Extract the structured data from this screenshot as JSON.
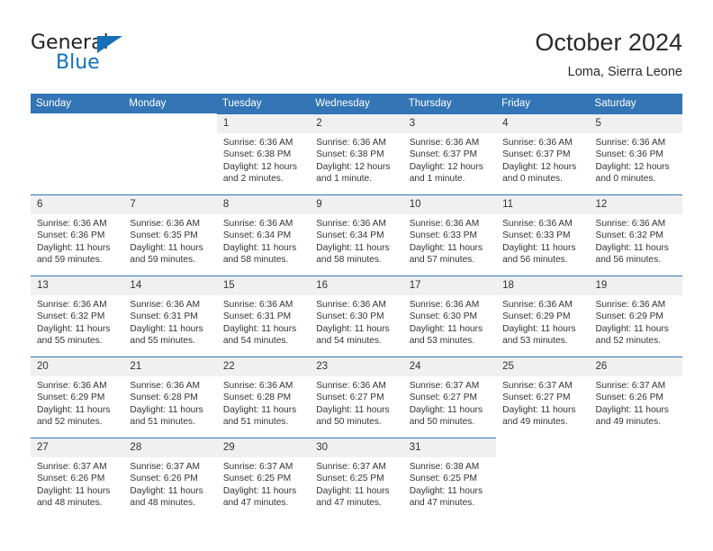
{
  "brand": {
    "name_top": "General",
    "name_bottom": "Blue",
    "accent_color": "#1570b8"
  },
  "header": {
    "title": "October 2024",
    "subtitle": "Loma, Sierra Leone",
    "header_bg_color": "#3375b5",
    "daynum_bg_color": "#f0f0f0"
  },
  "weekday_headers": [
    "Sunday",
    "Monday",
    "Tuesday",
    "Wednesday",
    "Thursday",
    "Friday",
    "Saturday"
  ],
  "labels": {
    "sunrise": "Sunrise:",
    "sunset": "Sunset:",
    "daylight": "Daylight:"
  },
  "weeks": [
    [
      {
        "day": "",
        "blank": true
      },
      {
        "day": "",
        "blank": true
      },
      {
        "day": "1",
        "sunrise": "Sunrise: 6:36 AM",
        "sunset": "Sunset: 6:38 PM",
        "daylight": "Daylight: 12 hours and 2 minutes."
      },
      {
        "day": "2",
        "sunrise": "Sunrise: 6:36 AM",
        "sunset": "Sunset: 6:38 PM",
        "daylight": "Daylight: 12 hours and 1 minute."
      },
      {
        "day": "3",
        "sunrise": "Sunrise: 6:36 AM",
        "sunset": "Sunset: 6:37 PM",
        "daylight": "Daylight: 12 hours and 1 minute."
      },
      {
        "day": "4",
        "sunrise": "Sunrise: 6:36 AM",
        "sunset": "Sunset: 6:37 PM",
        "daylight": "Daylight: 12 hours and 0 minutes."
      },
      {
        "day": "5",
        "sunrise": "Sunrise: 6:36 AM",
        "sunset": "Sunset: 6:36 PM",
        "daylight": "Daylight: 12 hours and 0 minutes."
      }
    ],
    [
      {
        "day": "6",
        "sunrise": "Sunrise: 6:36 AM",
        "sunset": "Sunset: 6:36 PM",
        "daylight": "Daylight: 11 hours and 59 minutes."
      },
      {
        "day": "7",
        "sunrise": "Sunrise: 6:36 AM",
        "sunset": "Sunset: 6:35 PM",
        "daylight": "Daylight: 11 hours and 59 minutes."
      },
      {
        "day": "8",
        "sunrise": "Sunrise: 6:36 AM",
        "sunset": "Sunset: 6:34 PM",
        "daylight": "Daylight: 11 hours and 58 minutes."
      },
      {
        "day": "9",
        "sunrise": "Sunrise: 6:36 AM",
        "sunset": "Sunset: 6:34 PM",
        "daylight": "Daylight: 11 hours and 58 minutes."
      },
      {
        "day": "10",
        "sunrise": "Sunrise: 6:36 AM",
        "sunset": "Sunset: 6:33 PM",
        "daylight": "Daylight: 11 hours and 57 minutes."
      },
      {
        "day": "11",
        "sunrise": "Sunrise: 6:36 AM",
        "sunset": "Sunset: 6:33 PM",
        "daylight": "Daylight: 11 hours and 56 minutes."
      },
      {
        "day": "12",
        "sunrise": "Sunrise: 6:36 AM",
        "sunset": "Sunset: 6:32 PM",
        "daylight": "Daylight: 11 hours and 56 minutes."
      }
    ],
    [
      {
        "day": "13",
        "sunrise": "Sunrise: 6:36 AM",
        "sunset": "Sunset: 6:32 PM",
        "daylight": "Daylight: 11 hours and 55 minutes."
      },
      {
        "day": "14",
        "sunrise": "Sunrise: 6:36 AM",
        "sunset": "Sunset: 6:31 PM",
        "daylight": "Daylight: 11 hours and 55 minutes."
      },
      {
        "day": "15",
        "sunrise": "Sunrise: 6:36 AM",
        "sunset": "Sunset: 6:31 PM",
        "daylight": "Daylight: 11 hours and 54 minutes."
      },
      {
        "day": "16",
        "sunrise": "Sunrise: 6:36 AM",
        "sunset": "Sunset: 6:30 PM",
        "daylight": "Daylight: 11 hours and 54 minutes."
      },
      {
        "day": "17",
        "sunrise": "Sunrise: 6:36 AM",
        "sunset": "Sunset: 6:30 PM",
        "daylight": "Daylight: 11 hours and 53 minutes."
      },
      {
        "day": "18",
        "sunrise": "Sunrise: 6:36 AM",
        "sunset": "Sunset: 6:29 PM",
        "daylight": "Daylight: 11 hours and 53 minutes."
      },
      {
        "day": "19",
        "sunrise": "Sunrise: 6:36 AM",
        "sunset": "Sunset: 6:29 PM",
        "daylight": "Daylight: 11 hours and 52 minutes."
      }
    ],
    [
      {
        "day": "20",
        "sunrise": "Sunrise: 6:36 AM",
        "sunset": "Sunset: 6:29 PM",
        "daylight": "Daylight: 11 hours and 52 minutes."
      },
      {
        "day": "21",
        "sunrise": "Sunrise: 6:36 AM",
        "sunset": "Sunset: 6:28 PM",
        "daylight": "Daylight: 11 hours and 51 minutes."
      },
      {
        "day": "22",
        "sunrise": "Sunrise: 6:36 AM",
        "sunset": "Sunset: 6:28 PM",
        "daylight": "Daylight: 11 hours and 51 minutes."
      },
      {
        "day": "23",
        "sunrise": "Sunrise: 6:36 AM",
        "sunset": "Sunset: 6:27 PM",
        "daylight": "Daylight: 11 hours and 50 minutes."
      },
      {
        "day": "24",
        "sunrise": "Sunrise: 6:37 AM",
        "sunset": "Sunset: 6:27 PM",
        "daylight": "Daylight: 11 hours and 50 minutes."
      },
      {
        "day": "25",
        "sunrise": "Sunrise: 6:37 AM",
        "sunset": "Sunset: 6:27 PM",
        "daylight": "Daylight: 11 hours and 49 minutes."
      },
      {
        "day": "26",
        "sunrise": "Sunrise: 6:37 AM",
        "sunset": "Sunset: 6:26 PM",
        "daylight": "Daylight: 11 hours and 49 minutes."
      }
    ],
    [
      {
        "day": "27",
        "sunrise": "Sunrise: 6:37 AM",
        "sunset": "Sunset: 6:26 PM",
        "daylight": "Daylight: 11 hours and 48 minutes."
      },
      {
        "day": "28",
        "sunrise": "Sunrise: 6:37 AM",
        "sunset": "Sunset: 6:26 PM",
        "daylight": "Daylight: 11 hours and 48 minutes."
      },
      {
        "day": "29",
        "sunrise": "Sunrise: 6:37 AM",
        "sunset": "Sunset: 6:25 PM",
        "daylight": "Daylight: 11 hours and 47 minutes."
      },
      {
        "day": "30",
        "sunrise": "Sunrise: 6:37 AM",
        "sunset": "Sunset: 6:25 PM",
        "daylight": "Daylight: 11 hours and 47 minutes."
      },
      {
        "day": "31",
        "sunrise": "Sunrise: 6:38 AM",
        "sunset": "Sunset: 6:25 PM",
        "daylight": "Daylight: 11 hours and 47 minutes."
      },
      {
        "day": "",
        "blank": true
      },
      {
        "day": "",
        "blank": true
      }
    ]
  ]
}
